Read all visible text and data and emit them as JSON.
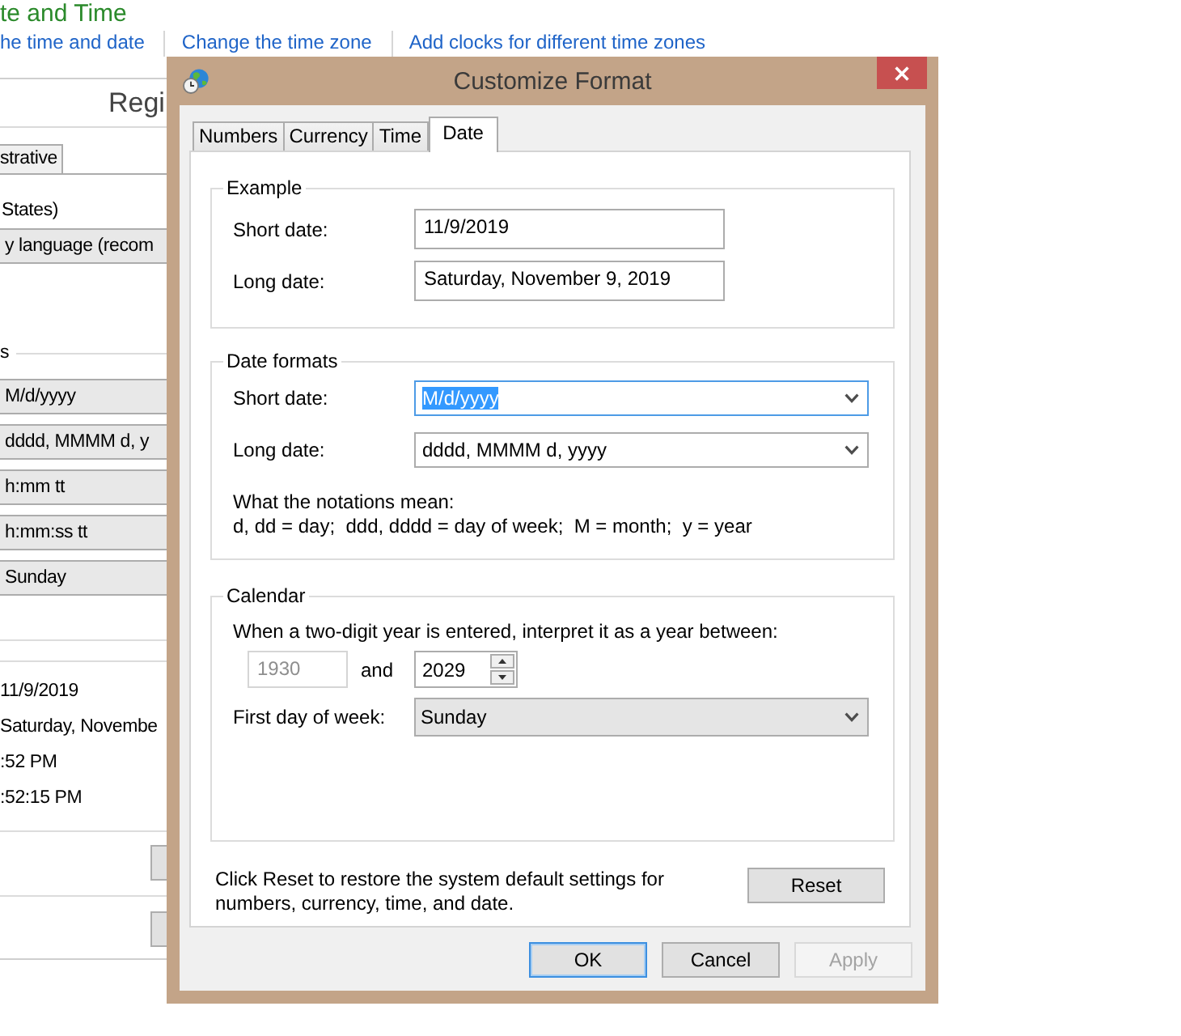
{
  "control_panel": {
    "title": "te and Time",
    "links": [
      "he time and date",
      "Change the time zone",
      "Add clocks for different time zones"
    ]
  },
  "region_window": {
    "title": "Regi",
    "tabs": [
      {
        "label": "strative",
        "selected": false
      }
    ],
    "format": "States)",
    "language_dropdown": "y language (recom",
    "section_label": "s",
    "format_dropdowns": [
      "M/d/yyyy",
      "dddd, MMMM d, y",
      "h:mm tt",
      "h:mm:ss tt",
      "Sunday"
    ],
    "examples": [
      "11/9/2019",
      "Saturday, Novembe",
      ":52 PM",
      ":52:15 PM"
    ]
  },
  "dialog": {
    "title": "Customize Format",
    "tabs": [
      {
        "label": "Numbers",
        "selected": false
      },
      {
        "label": "Currency",
        "selected": false
      },
      {
        "label": "Time",
        "selected": false
      },
      {
        "label": "Date",
        "selected": true
      }
    ],
    "example_group": {
      "title": "Example",
      "rows": [
        {
          "label": "Short date:",
          "value": "11/9/2019"
        },
        {
          "label": "Long date:",
          "value": "Saturday, November 9, 2019"
        }
      ]
    },
    "formats_group": {
      "title": "Date formats",
      "rows": [
        {
          "label": "Short date:",
          "value": "M/d/yyyy",
          "focused": true
        },
        {
          "label": "Long date:",
          "value": "dddd, MMMM d, yyyy",
          "focused": false
        }
      ],
      "notations_title": "What the notations mean:",
      "notations": "d, dd = day;  ddd, dddd = day of week;  M = month;  y = year"
    },
    "calendar_group": {
      "title": "Calendar",
      "year_range_label": "When a two-digit year is entered, interpret it as a year between:",
      "start_year": {
        "value": "1930",
        "disabled": true
      },
      "and_label": "and",
      "end_year": {
        "value": "2029",
        "disabled": false
      },
      "first_day_label": "First day of week:",
      "first_day": "Sunday"
    },
    "reset_note": "Click Reset to restore the system default settings for numbers, currency, time, and date.",
    "reset_button": "Reset",
    "buttons": [
      {
        "label": "OK",
        "default": true,
        "disabled": false
      },
      {
        "label": "Cancel",
        "default": false,
        "disabled": false
      },
      {
        "label": "Apply",
        "default": false,
        "disabled": true
      }
    ]
  }
}
